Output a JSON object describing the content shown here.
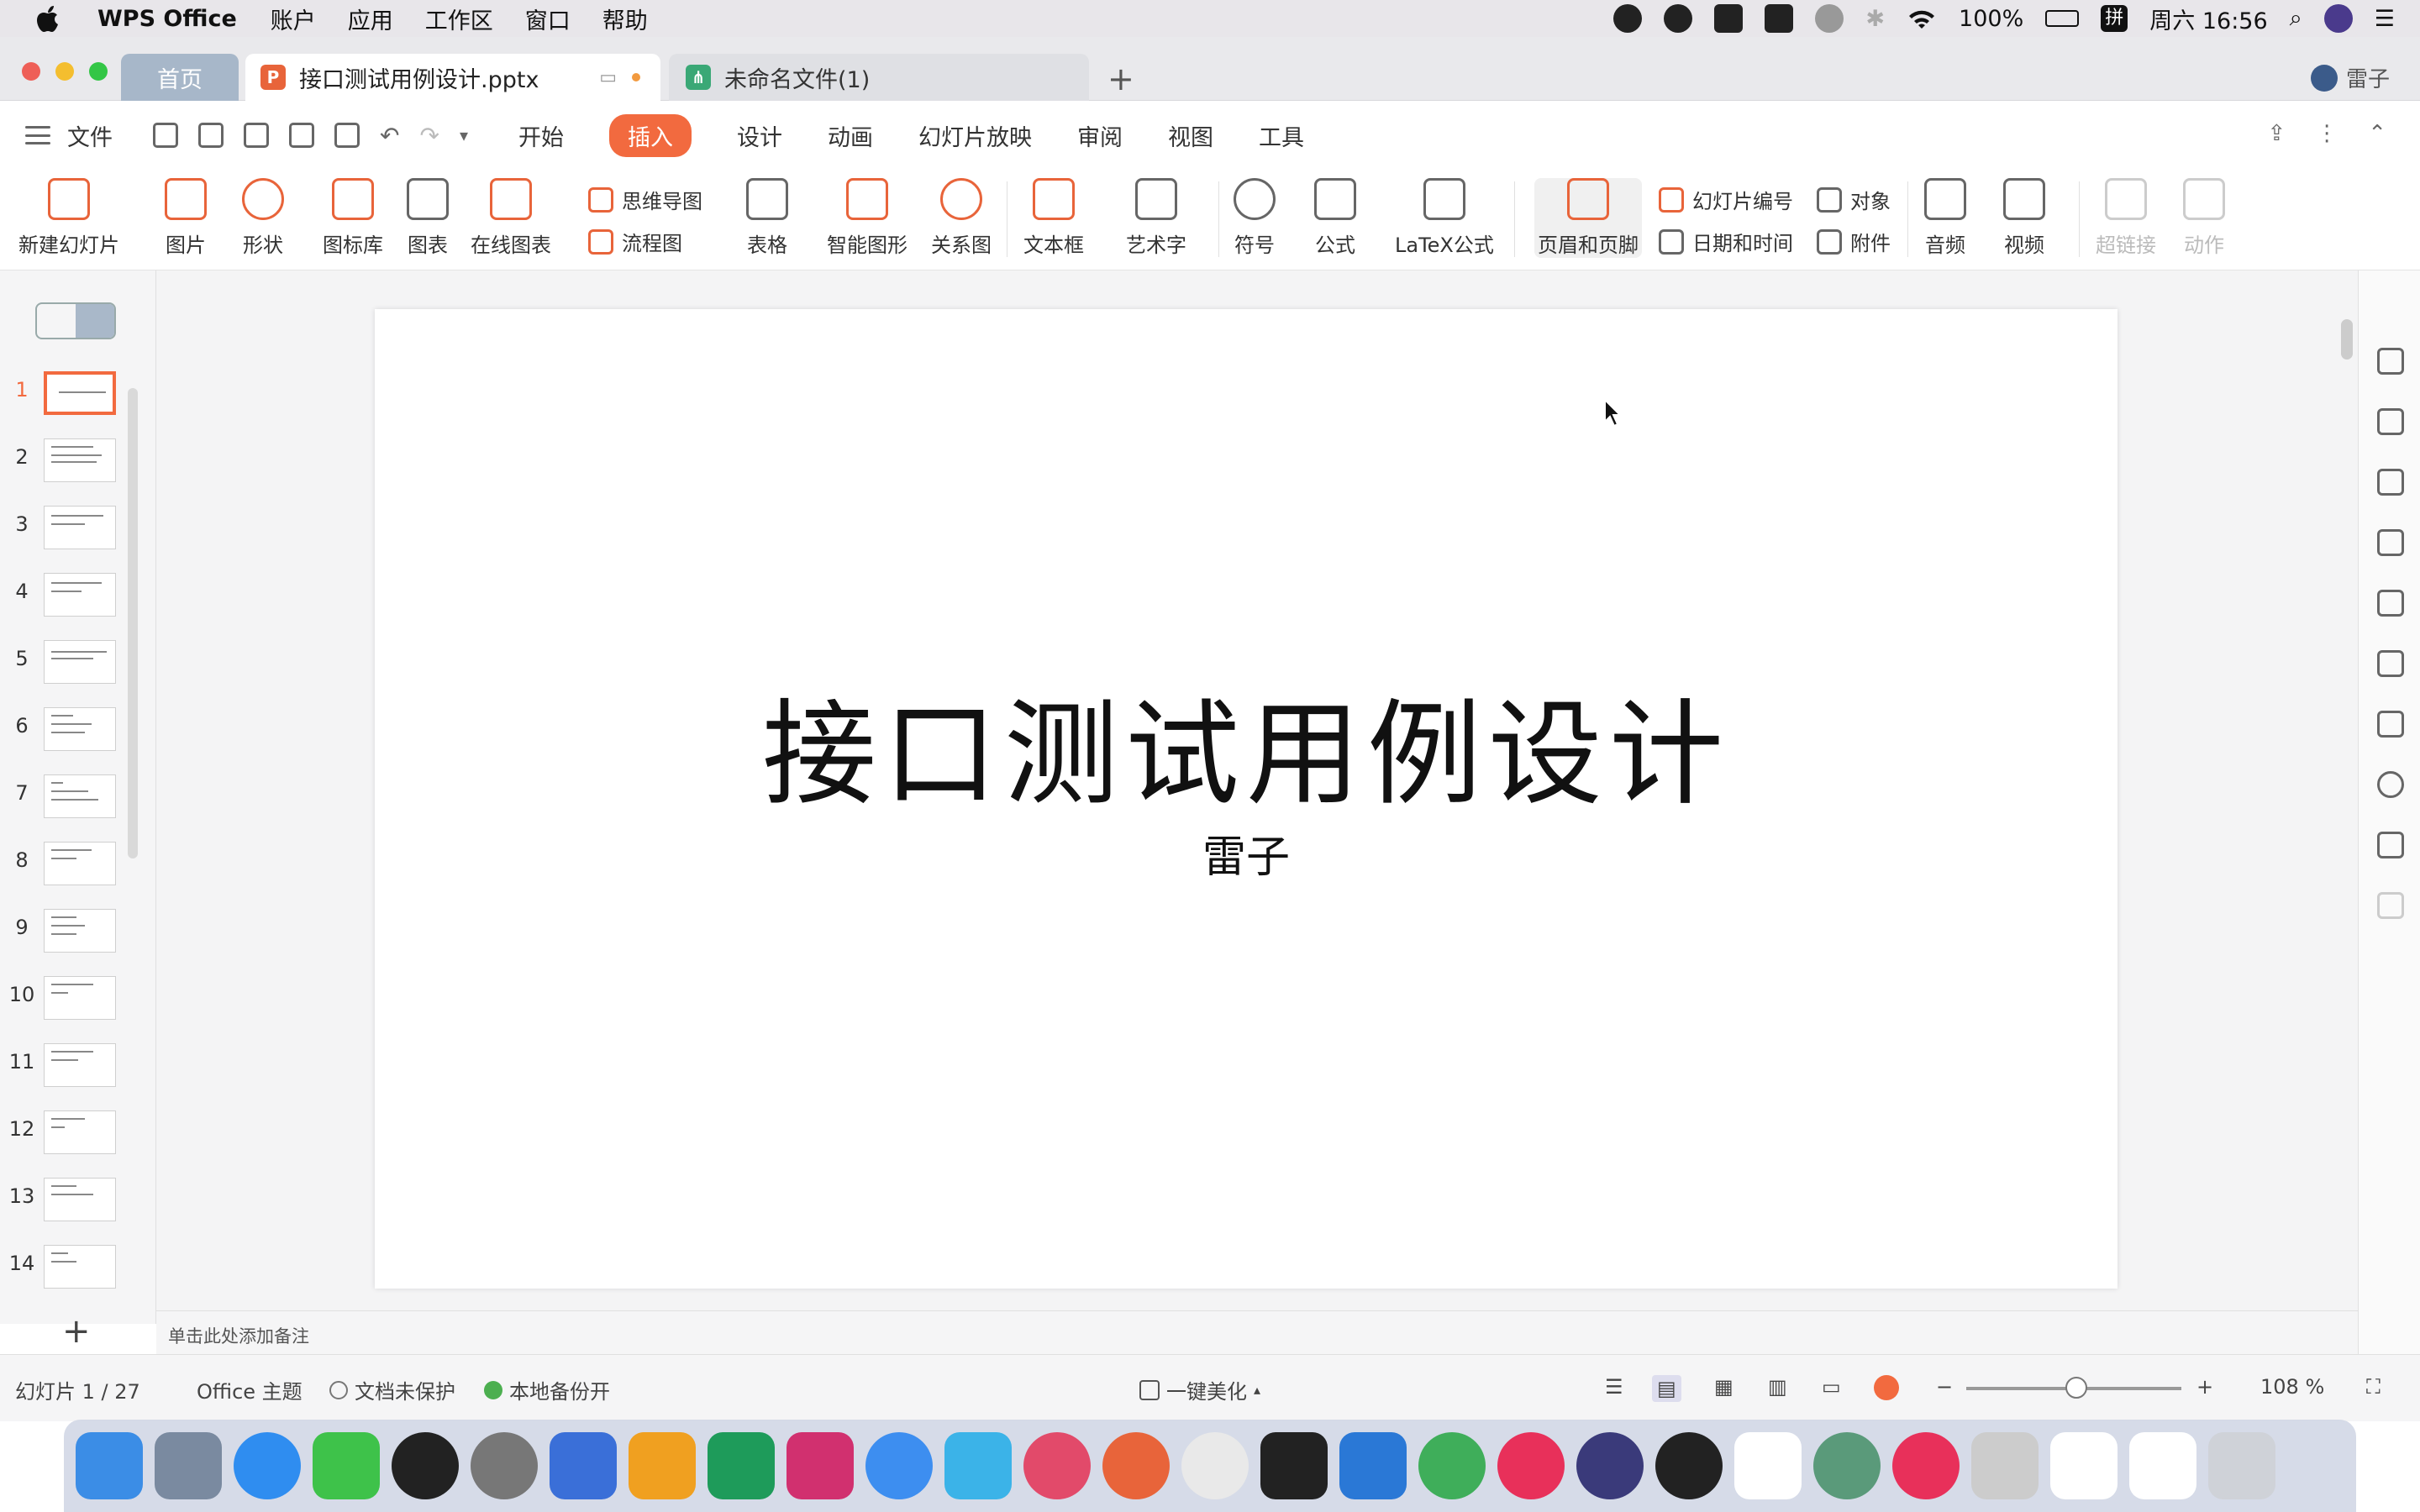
{
  "menubar": {
    "app": "WPS Office",
    "items": [
      "账户",
      "应用",
      "工作区",
      "窗口",
      "帮助"
    ],
    "battery": "100%",
    "ime": "拼",
    "clock": "周六 16:56"
  },
  "tabs": {
    "home": "首页",
    "doc": "接口测试用例设计.pptx",
    "doc2": "未命名文件(1)",
    "user": "雷子"
  },
  "menu": {
    "file": "文件",
    "tabs": [
      "开始",
      "插入",
      "设计",
      "动画",
      "幻灯片放映",
      "审阅",
      "视图",
      "工具"
    ],
    "active": "插入"
  },
  "ribbon": {
    "new_slide": "新建幻灯片",
    "picture": "图片",
    "shape": "形状",
    "icon_lib": "图标库",
    "chart": "图表",
    "online_chart": "在线图表",
    "mindmap": "思维导图",
    "flowchart": "流程图",
    "table": "表格",
    "smart_shape": "智能图形",
    "relation": "关系图",
    "textbox": "文本框",
    "wordart": "艺术字",
    "symbol": "符号",
    "formula": "公式",
    "latex": "LaTeX公式",
    "header_footer": "页眉和页脚",
    "slide_number": "幻灯片编号",
    "object": "对象",
    "datetime": "日期和时间",
    "attachment": "附件",
    "audio": "音频",
    "video": "视频",
    "hyperlink": "超链接",
    "action": "动作"
  },
  "thumbnails": [
    "1",
    "2",
    "3",
    "4",
    "5",
    "6",
    "7",
    "8",
    "9",
    "10",
    "11",
    "12",
    "13",
    "14"
  ],
  "slide": {
    "title": "接口测试用例设计",
    "subtitle": "雷子"
  },
  "notes_placeholder": "单击此处添加备注",
  "status": {
    "slide_counter": "幻灯片 1 / 27",
    "theme": "Office 主题",
    "protect": "文档未保护",
    "backup": "本地备份开",
    "beautify": "一键美化",
    "zoom": "108 %"
  },
  "colors": {
    "accent": "#f26a3f",
    "home_tab": "#a7b7c9"
  }
}
